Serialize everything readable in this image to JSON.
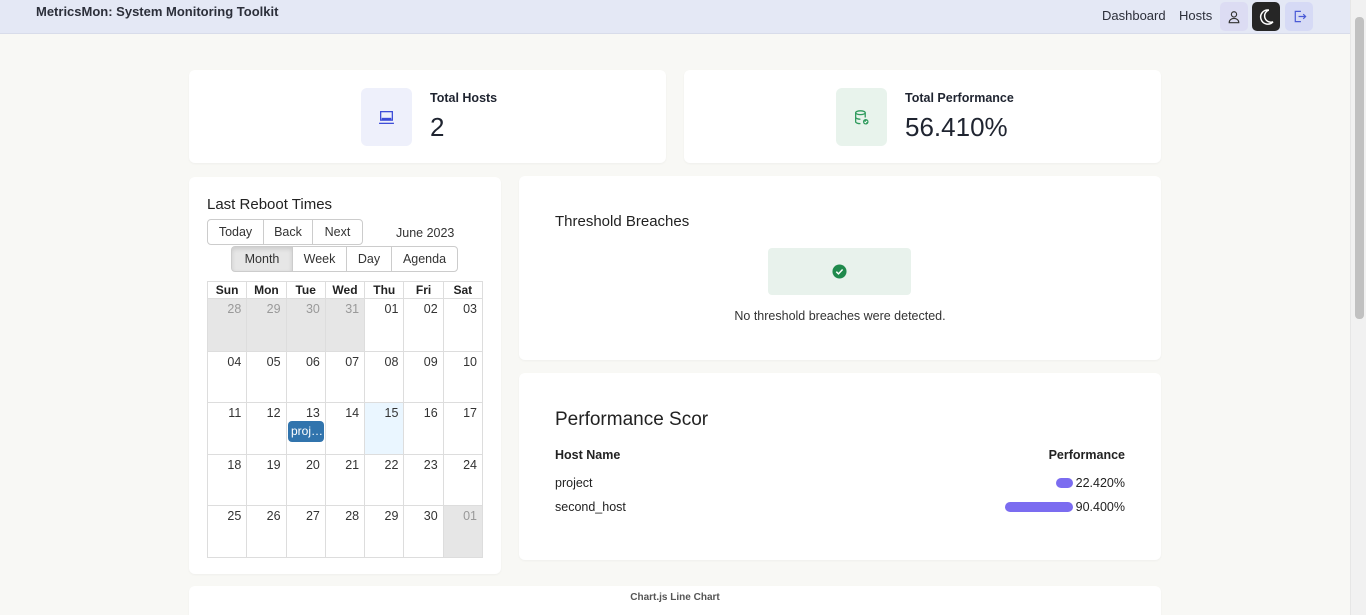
{
  "app": {
    "title": "MetricsMon: System Monitoring Toolkit"
  },
  "nav": {
    "dashboard": "Dashboard",
    "hosts": "Hosts",
    "icons": {
      "user": "user-icon",
      "theme": "moon-icon",
      "logout": "logout-icon"
    }
  },
  "stats": {
    "hosts": {
      "label": "Total Hosts",
      "value": "2",
      "icon": "laptop-icon",
      "icon_bg": "#eef0fb",
      "icon_color": "#3b4bd8"
    },
    "performance": {
      "label": "Total Performance",
      "value": "56.410%",
      "icon": "database-check-icon",
      "icon_bg": "#e8f3ec",
      "icon_color": "#2e9a5c"
    }
  },
  "calendar": {
    "title": "Last Reboot Times",
    "toolbar": {
      "today": "Today",
      "back": "Back",
      "next": "Next",
      "label": "June 2023"
    },
    "views": {
      "month": "Month",
      "week": "Week",
      "day": "Day",
      "agenda": "Agenda",
      "active": "Month"
    },
    "weekdays": [
      "Sun",
      "Mon",
      "Tue",
      "Wed",
      "Thu",
      "Fri",
      "Sat"
    ],
    "weeks": [
      [
        "28",
        "29",
        "30",
        "31",
        "01",
        "02",
        "03"
      ],
      [
        "04",
        "05",
        "06",
        "07",
        "08",
        "09",
        "10"
      ],
      [
        "11",
        "12",
        "13",
        "14",
        "15",
        "16",
        "17"
      ],
      [
        "18",
        "19",
        "20",
        "21",
        "22",
        "23",
        "24"
      ],
      [
        "25",
        "26",
        "27",
        "28",
        "29",
        "30",
        "01"
      ]
    ],
    "off_range": [
      [
        0,
        0
      ],
      [
        0,
        1
      ],
      [
        0,
        2
      ],
      [
        0,
        3
      ],
      [
        4,
        6
      ]
    ],
    "today_cell": [
      2,
      4
    ],
    "event": {
      "label": "proj…",
      "color": "#3174ad"
    }
  },
  "breaches": {
    "title": "Threshold Breaches",
    "message": "No threshold breaches were detected.",
    "icon": "check-circle-icon",
    "icon_color": "#1f8a4c"
  },
  "performance": {
    "title": "Performance Scor",
    "col_host": "Host Name",
    "col_perf": "Performance",
    "bar_color": "#7b6cf0",
    "rows": [
      {
        "host": "project",
        "value": "22.420%",
        "fraction": 0.2242
      },
      {
        "host": "second_host",
        "value": "90.400%",
        "fraction": 0.904
      }
    ]
  },
  "chart": {
    "caption": "Chart.js Line Chart"
  }
}
